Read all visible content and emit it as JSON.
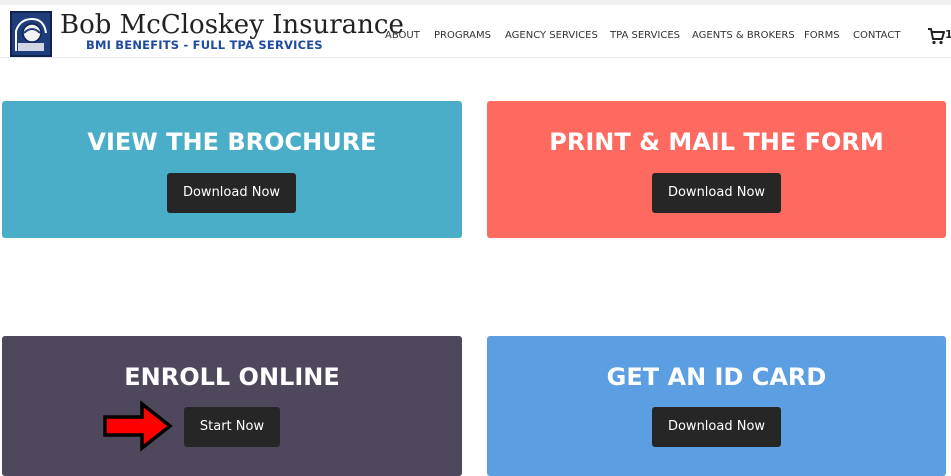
{
  "header": {
    "logo_title": "Bob McCloskey Insurance",
    "logo_subtitle": "BMI BENEFITS - FULL TPA SERVICES",
    "nav": [
      {
        "label": "ABOUT"
      },
      {
        "label": "PROGRAMS"
      },
      {
        "label": "AGENCY SERVICES"
      },
      {
        "label": "TPA SERVICES"
      },
      {
        "label": "AGENTS & BROKERS"
      },
      {
        "label": "FORMS"
      },
      {
        "label": "CONTACT"
      }
    ],
    "cart_icon": "cart-icon",
    "cart_count": "1"
  },
  "cards": {
    "brochure": {
      "title": "VIEW THE BROCHURE",
      "button": "Download Now",
      "color": "#4aaec8"
    },
    "print_form": {
      "title": "PRINT & MAIL THE FORM",
      "button": "Download Now",
      "color": "#fe6a5f"
    },
    "enroll": {
      "title": "ENROLL ONLINE",
      "button": "Start Now",
      "color": "#4f475b"
    },
    "id_card": {
      "title": "GET AN ID CARD",
      "button": "Download Now",
      "color": "#5b9fe2"
    }
  },
  "annotation": {
    "icon": "red-arrow-icon",
    "color": "#ff0000"
  }
}
